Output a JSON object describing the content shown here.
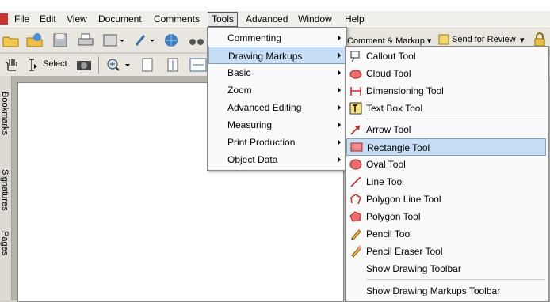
{
  "menubar": {
    "items": [
      "File",
      "Edit",
      "View",
      "Document",
      "Comments",
      "Tools",
      "Advanced",
      "Window",
      "Help"
    ]
  },
  "toolbar": {
    "select_label": "Select",
    "comment_markup_label": "Comment & Markup",
    "send_review_label": "Send for Review"
  },
  "leftnav": {
    "tabs": [
      "Bookmarks",
      "Signatures",
      "Pages"
    ]
  },
  "tools_menu": {
    "items": [
      "Commenting",
      "Drawing Markups",
      "Basic",
      "Zoom",
      "Advanced Editing",
      "Measuring",
      "Print Production",
      "Object Data"
    ],
    "highlighted": "Drawing Markups"
  },
  "drawing_submenu": {
    "items": [
      {
        "label": "Callout Tool",
        "icon": "callout-icon"
      },
      {
        "label": "Cloud Tool",
        "icon": "cloud-icon"
      },
      {
        "label": "Dimensioning Tool",
        "icon": "dimension-icon"
      },
      {
        "label": "Text Box Tool",
        "icon": "textbox-icon"
      },
      {
        "label": "Arrow Tool",
        "icon": "arrow-icon"
      },
      {
        "label": "Rectangle Tool",
        "icon": "rectangle-icon"
      },
      {
        "label": "Oval Tool",
        "icon": "oval-icon"
      },
      {
        "label": "Line Tool",
        "icon": "line-icon"
      },
      {
        "label": "Polygon Line Tool",
        "icon": "polygon-line-icon"
      },
      {
        "label": "Polygon Tool",
        "icon": "polygon-icon"
      },
      {
        "label": "Pencil Tool",
        "icon": "pencil-icon"
      },
      {
        "label": "Pencil Eraser Tool",
        "icon": "pencil-eraser-icon"
      },
      {
        "label": "Show Drawing Toolbar",
        "icon": ""
      },
      {
        "label": "Show Drawing Markups Toolbar",
        "icon": ""
      }
    ],
    "highlighted": "Rectangle Tool"
  }
}
